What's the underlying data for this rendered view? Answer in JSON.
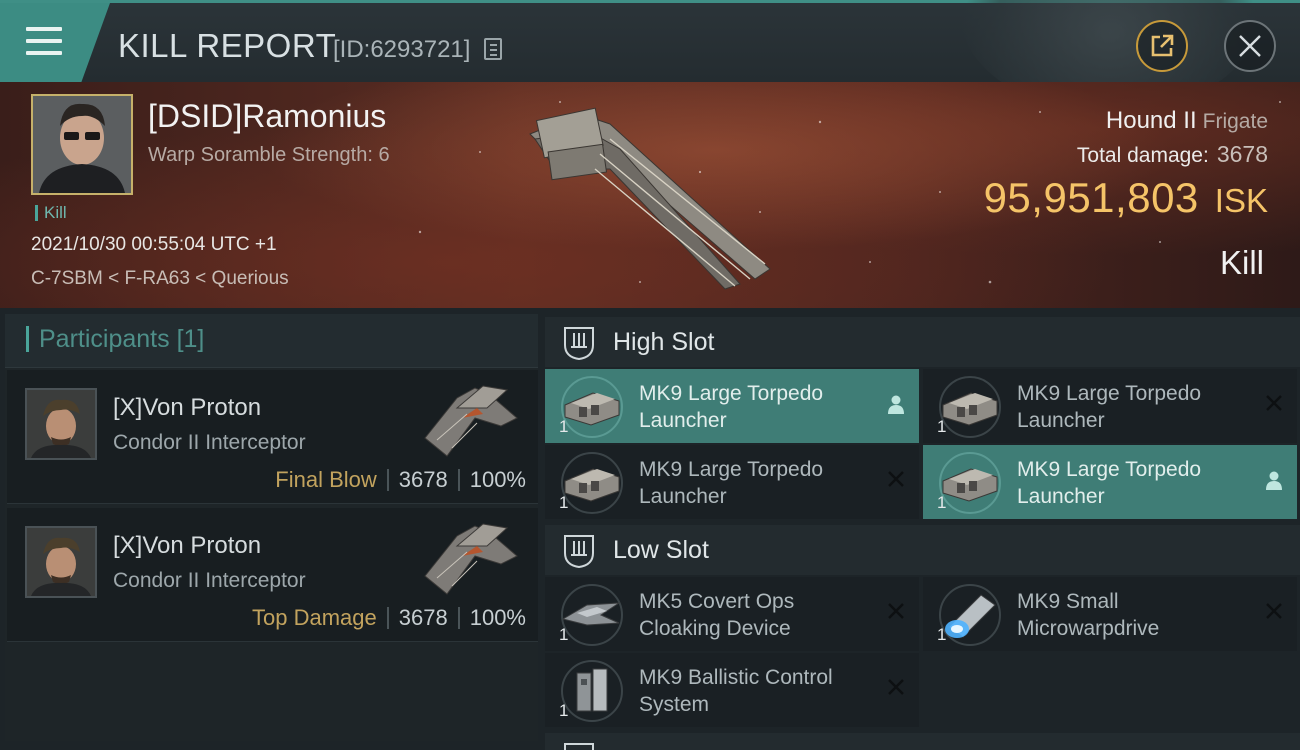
{
  "header": {
    "title": "KILL REPORT",
    "report_id": "[ID:6293721]",
    "icons": {
      "menu": "hamburger-menu-icon",
      "copy": "copy-icon",
      "share": "share-icon",
      "close": "close-icon"
    },
    "colors": {
      "accent": "#3c8c83",
      "share_ring": "#c79a3a"
    }
  },
  "victim": {
    "pilot_name": "[DSID]Ramonius",
    "warp_scramble": "Warp Soramble Strength: 6",
    "kill_tag": "Kill",
    "datetime": "2021/10/30 00:55:04 UTC +1",
    "location": "C-7SBM < F-RA63 < Querious",
    "ship_name": "Hound II",
    "ship_class": "Frigate",
    "total_damage_label": "Total damage:",
    "total_damage": "3678",
    "isk_value": "95,951,803",
    "isk_unit": "ISK",
    "result": "Kill",
    "colors": {
      "isk": "#f5c468"
    }
  },
  "participants": {
    "title": "Participants",
    "count": "[1]",
    "list": [
      {
        "name": "[X]Von Proton",
        "ship": "Condor II Interceptor",
        "role": "Final Blow",
        "damage": "3678",
        "percent": "100%"
      },
      {
        "name": "[X]Von Proton",
        "ship": "Condor II Interceptor",
        "role": "Top Damage",
        "damage": "3678",
        "percent": "100%"
      }
    ]
  },
  "slots": {
    "high": {
      "label": "High Slot",
      "items": [
        {
          "name": "MK9 Large Torpedo Launcher",
          "qty": "1",
          "status": "person-icon"
        },
        {
          "name": "MK9 Large Torpedo Launcher",
          "qty": "1",
          "status": "close-icon"
        },
        {
          "name": "MK9 Large Torpedo Launcher",
          "qty": "1",
          "status": "close-icon"
        },
        {
          "name": "MK9 Large Torpedo Launcher",
          "qty": "1",
          "status": "person-icon"
        }
      ]
    },
    "low": {
      "label": "Low Slot",
      "items": [
        {
          "name": "MK5 Covert Ops Cloaking Device",
          "qty": "1",
          "status": "close-icon"
        },
        {
          "name": "MK9 Small Microwarpdrive",
          "qty": "1",
          "status": "close-icon"
        },
        {
          "name": "MK9 Ballistic Control System",
          "qty": "1",
          "status": "close-icon"
        }
      ]
    }
  }
}
